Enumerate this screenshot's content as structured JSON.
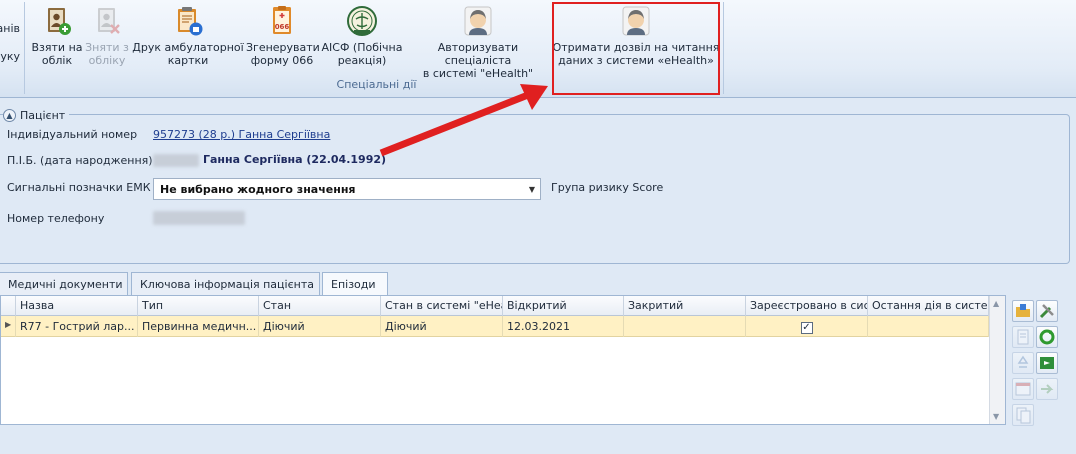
{
  "ribbon": {
    "left_partial": [
      "анів",
      "уку"
    ],
    "buttons": [
      {
        "label": "Взяти на\nоблік",
        "icon": "add-record-icon",
        "disabled": false
      },
      {
        "label": "Зняти з\nобліку",
        "icon": "remove-record-icon",
        "disabled": true
      },
      {
        "label": "Друк амбулаторної\nкартки",
        "icon": "print-card-icon",
        "disabled": false
      },
      {
        "label": "Згенерувати\nформу 066",
        "icon": "form-066-icon",
        "disabled": false
      },
      {
        "label": "АІСФ (Побічна\nреакція)",
        "icon": "aisf-emblem-icon",
        "disabled": false
      },
      {
        "label": "Авторизувати спеціаліста\nв системі \"eHealth\"",
        "icon": "ehealth-user-icon",
        "disabled": false
      },
      {
        "label": "Отримати дозвіл на читання\nданих з системи «eHealth»",
        "icon": "ehealth-user-icon",
        "disabled": false
      }
    ],
    "group_caption": "Спеціальні дії"
  },
  "patient": {
    "section_title": "Пацієнт",
    "id_label": "Індивідуальний номер",
    "id_value": "957273 (28 р.) Ганна Сергіївна",
    "fio_label": "П.І.Б. (дата народження)",
    "fio_value": "Ганна Сергіївна (22.04.1992)",
    "signal_label": "Сигнальні позначки ЕМК",
    "signal_value": "Не вибрано жодного значення",
    "score_label": "Група ризику Score",
    "phone_label": "Номер телефону"
  },
  "tabs": [
    {
      "label": "Медичні документи",
      "active": false
    },
    {
      "label": "Ключова інформація пацієнта",
      "active": false
    },
    {
      "label": "Епізоди",
      "active": true
    }
  ],
  "grid": {
    "columns": [
      "Назва",
      "Тип",
      "Стан",
      "Стан в системі \"eHea",
      "Відкритий",
      "Закритий",
      "Зареєстровано в сис",
      "Остання дія в систем"
    ],
    "rows": [
      {
        "name": "R77 - Гострий лар...",
        "type": "Первинна медичн...",
        "state": "Діючий",
        "ehealth_state": "Діючий",
        "opened": "12.03.2021",
        "closed": "",
        "registered": true,
        "last_action": ""
      }
    ]
  },
  "colors": {
    "highlight": "#e02020",
    "selected_row": "#fff1c4",
    "link": "#1e3d8f"
  }
}
